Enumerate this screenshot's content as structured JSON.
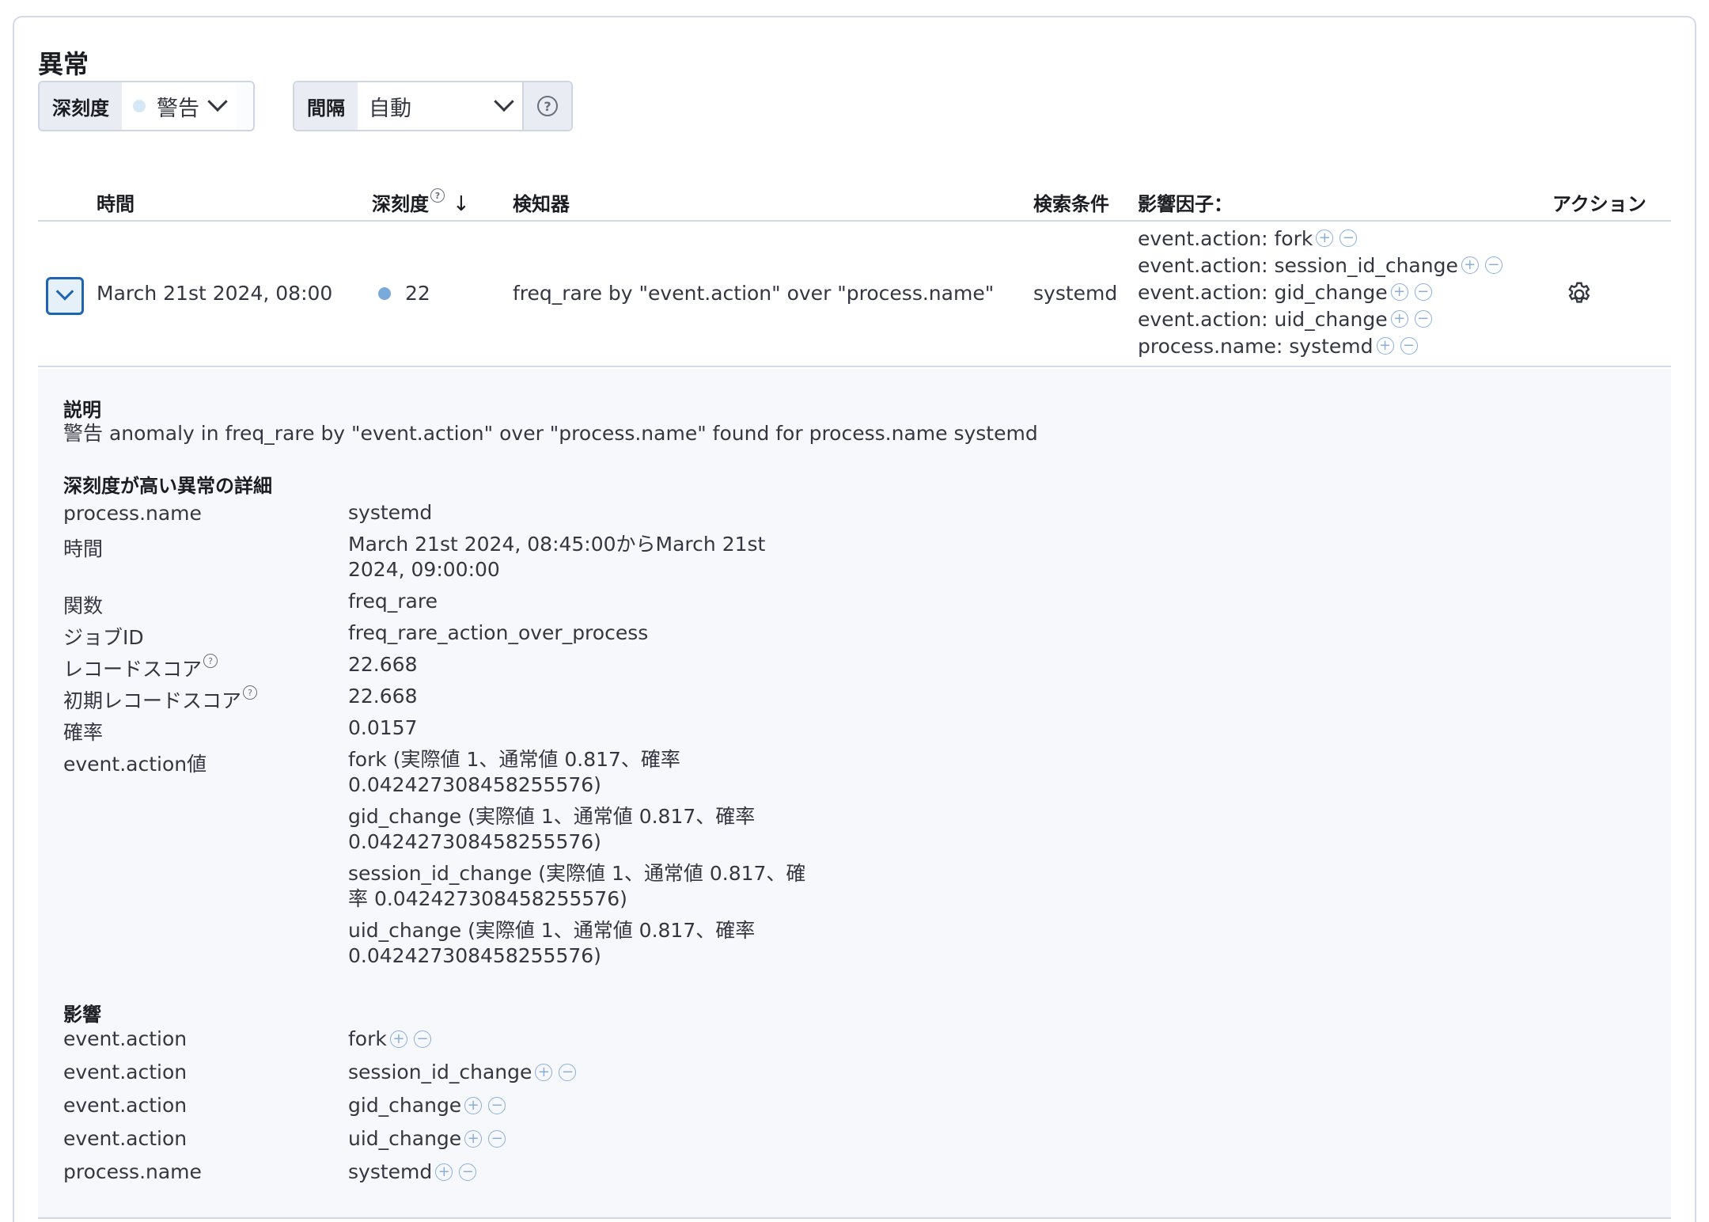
{
  "title": "異常",
  "severity_control": {
    "label": "深刻度",
    "value": "警告",
    "dot_color": "#d6e8f7"
  },
  "interval_control": {
    "label": "間隔",
    "value": "自動",
    "help_glyph": "?"
  },
  "table": {
    "headers": {
      "time": "時間",
      "severity": "深刻度",
      "detector": "検知器",
      "found_for": "検索条件",
      "influencers": "影響因子：",
      "actions": "アクション"
    },
    "row": {
      "time": "March 21st 2024, 08:00",
      "severity": "22",
      "severity_dot_color": "#79aad9",
      "detector": "freq_rare by \"event.action\" over \"process.name\"",
      "found_for": "systemd",
      "influencers": [
        "event.action: fork",
        "event.action: session_id_change",
        "event.action: gid_change",
        "event.action: uid_change",
        "process.name: systemd"
      ]
    }
  },
  "details": {
    "description_title": "説明",
    "description": "警告 anomaly in freq_rare by \"event.action\" over \"process.name\" found for process.name systemd",
    "anomaly_title": "深刻度が高い異常の詳細",
    "fields": [
      {
        "label": "process.name",
        "value": "systemd"
      },
      {
        "label": "時間",
        "value": "March 21st 2024, 08:45:00からMarch 21st 2024, 09:00:00"
      },
      {
        "label": "関数",
        "value": "freq_rare"
      },
      {
        "label": "ジョブID",
        "value": "freq_rare_action_over_process"
      },
      {
        "label": "レコードスコア",
        "value": "22.668"
      },
      {
        "label": "初期レコードスコア",
        "value": "22.668"
      },
      {
        "label": "確率",
        "value": "0.0157"
      },
      {
        "label": "event.action値",
        "value": "fork (実際値 1、通常値 0.817、確率 0.042427308458255576)"
      }
    ],
    "extra_action_values": [
      "gid_change (実際値 1、通常値 0.817、確率 0.042427308458255576)",
      "session_id_change (実際値 1、通常値 0.817、確率 0.042427308458255576)",
      "uid_change (実際値 1、通常値 0.817、確率 0.042427308458255576)"
    ],
    "influencers_title": "影響",
    "influencers": [
      {
        "field": "event.action",
        "value": "fork"
      },
      {
        "field": "event.action",
        "value": "session_id_change"
      },
      {
        "field": "event.action",
        "value": "gid_change"
      },
      {
        "field": "event.action",
        "value": "uid_change"
      },
      {
        "field": "process.name",
        "value": "systemd"
      }
    ]
  },
  "icons": {
    "plus": "⊕",
    "minus": "⊖",
    "gear": "gear-icon",
    "sort": "↓"
  }
}
